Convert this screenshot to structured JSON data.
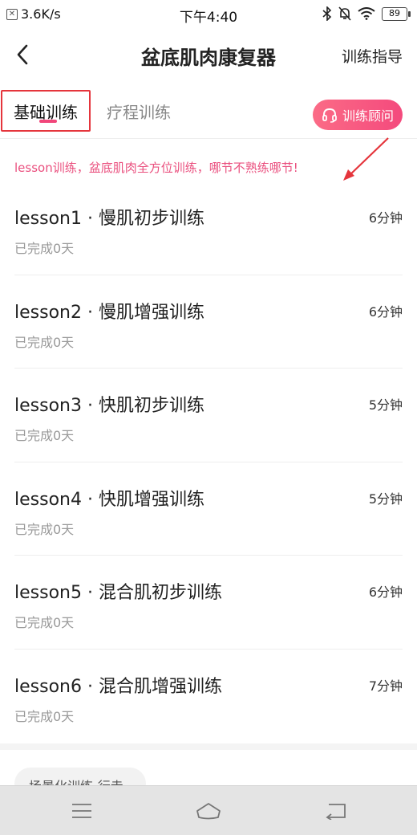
{
  "status_bar": {
    "net_speed": "3.6K/s",
    "time": "下午4:40",
    "battery": "89"
  },
  "header": {
    "title": "盆底肌肉康复器",
    "guide_link": "训练指导"
  },
  "tabs": [
    {
      "label": "基础训练",
      "active": true
    },
    {
      "label": "疗程训练",
      "active": false
    }
  ],
  "consult_button": {
    "label": "训练顾问"
  },
  "banner": {
    "text": "lesson训练，盆底肌肉全方位训练，哪节不熟练哪节!"
  },
  "lessons": [
    {
      "title": "lesson1 · 慢肌初步训练",
      "duration": "6分钟",
      "progress": "已完成0天"
    },
    {
      "title": "lesson2 · 慢肌增强训练",
      "duration": "6分钟",
      "progress": "已完成0天"
    },
    {
      "title": "lesson3 · 快肌初步训练",
      "duration": "5分钟",
      "progress": "已完成0天"
    },
    {
      "title": "lesson4 · 快肌增强训练",
      "duration": "5分钟",
      "progress": "已完成0天"
    },
    {
      "title": "lesson5 · 混合肌初步训练",
      "duration": "6分钟",
      "progress": "已完成0天"
    },
    {
      "title": "lesson6 · 混合肌增强训练",
      "duration": "7分钟",
      "progress": "已完成0天"
    }
  ],
  "scene_chip": {
    "label": "场景化训练-行走"
  },
  "colors": {
    "accent": "#f44a7d",
    "highlight_box": "#e5353c",
    "banner_text": "#ea4f7e"
  },
  "icons": {
    "back": "chevron-left-icon",
    "consult": "headset-icon",
    "nav_menu": "menu-icon",
    "nav_home": "home-icon",
    "nav_back": "return-icon"
  }
}
